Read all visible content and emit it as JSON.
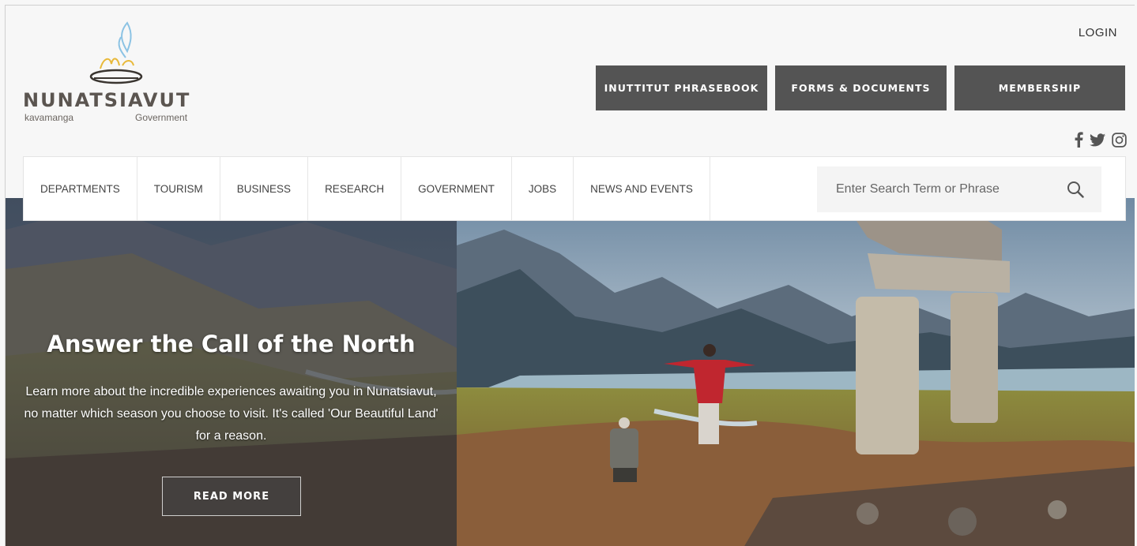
{
  "header": {
    "logo": {
      "word": "NUNATSIAVUT",
      "sub_left": "kavamanga",
      "sub_right": "Government"
    },
    "login_label": "LOGIN",
    "buttons": [
      "INUTTITUT PHRASEBOOK",
      "FORMS & DOCUMENTS",
      "MEMBERSHIP"
    ],
    "social": [
      "facebook-icon",
      "twitter-icon",
      "instagram-icon"
    ]
  },
  "nav": {
    "items": [
      "DEPARTMENTS",
      "TOURISM",
      "BUSINESS",
      "RESEARCH",
      "GOVERNMENT",
      "JOBS",
      "NEWS AND EVENTS"
    ],
    "search_placeholder": "Enter Search Term or Phrase"
  },
  "hero": {
    "title": "Answer the Call of the North",
    "text": "Learn more about the incredible experiences awaiting you in Nunatsiavut, no matter which season you choose to visit. It's called 'Our Beautiful Land' for a reason.",
    "button_label": "READ MORE"
  },
  "colors": {
    "button_bg": "#545454",
    "nav_bg": "#ffffff",
    "page_bg": "#f7f7f7"
  }
}
